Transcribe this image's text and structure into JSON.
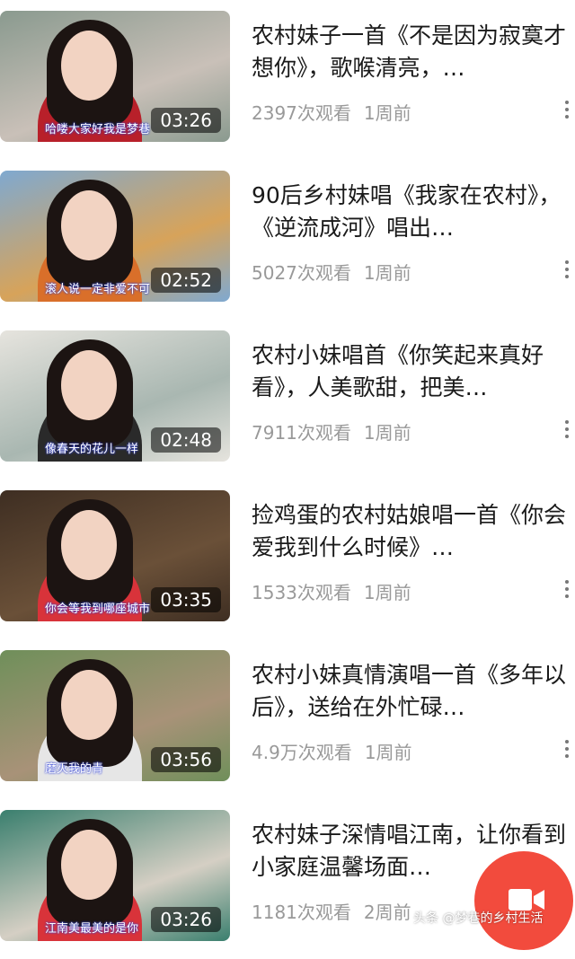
{
  "videos": [
    {
      "title": "农村妹子一首《不是因为寂寞才想你》，歌喉清亮，…",
      "views": "2397次观看",
      "age": "1周前",
      "duration": "03:26",
      "caption": "哈喽大家好我是梦巷",
      "bg": "#c9c0b8",
      "bg2": "#8a9a8f",
      "clothes": "#b8202a"
    },
    {
      "title": "90后乡村妹唱《我家在农村》，《逆流成河》唱出…",
      "views": "5027次观看",
      "age": "1周前",
      "duration": "02:52",
      "caption": "滚人说一定非爱不可",
      "bg": "#d7a35a",
      "bg2": "#7fa9d0",
      "clothes": "#d96f2a"
    },
    {
      "title": "农村小妹唱首《你笑起来真好看》，人美歌甜，把美…",
      "views": "7911次观看",
      "age": "1周前",
      "duration": "02:48",
      "caption": "像春天的花儿一样",
      "bg": "#a9b7b1",
      "bg2": "#e6e4de",
      "clothes": "#2a2a2a"
    },
    {
      "title": "捡鸡蛋的农村姑娘唱一首《你会爱我到什么时候》…",
      "views": "1533次观看",
      "age": "1周前",
      "duration": "03:35",
      "caption": "你会等我到哪座城市",
      "bg": "#6a5038",
      "bg2": "#3e2e22",
      "clothes": "#d8333a"
    },
    {
      "title": "农村小妹真情演唱一首《多年以后》，送给在外忙碌…",
      "views": "4.9万次观看",
      "age": "1周前",
      "duration": "03:56",
      "caption": "磨灭我的青",
      "bg": "#a89278",
      "bg2": "#6f8f5a",
      "clothes": "#e6e6e6"
    },
    {
      "title": "农村妹子深情唱江南，让你看到小家庭温馨场面…",
      "views": "1181次观看",
      "age": "2周前",
      "duration": "03:26",
      "caption": "江南美最美的是你",
      "bg": "#d5cfc4",
      "bg2": "#3a7f6e",
      "clothes": "#d8333a"
    }
  ],
  "watermark": "头条 @梦巷的乡村生活",
  "fab_icon": "video-camera-icon",
  "colors": {
    "fab": "#f24b3d",
    "meta": "#999999",
    "title": "#1a1a1a"
  }
}
